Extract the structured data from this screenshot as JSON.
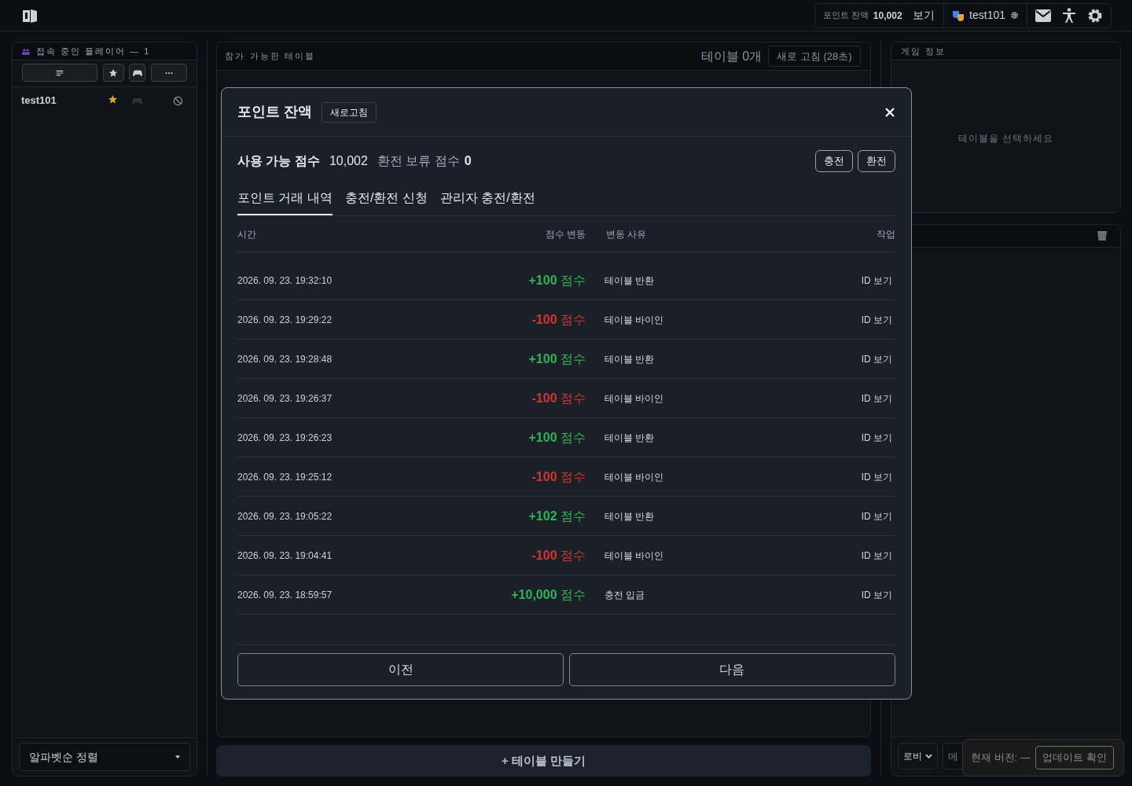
{
  "topbar": {
    "points_label": "포인트 잔액",
    "points_value": "10,002",
    "view_button": "보기",
    "username": "test101"
  },
  "players_panel": {
    "title": "접속 중인 플레이어 — 1",
    "players": [
      {
        "name": "test101",
        "favorite": true
      }
    ],
    "sort_select": "알파벳순 정렬"
  },
  "tables_panel": {
    "title": "참가 가능한 테이블",
    "count": "테이블 0개",
    "refresh_button": "새로 고침 (28초)",
    "create_button": "+ 테이블 만들기"
  },
  "game_info": {
    "title": "게임 정보",
    "empty": "테이블을 선택하세요"
  },
  "chat": {
    "channel": "로비",
    "placeholder": "메"
  },
  "version_toast": {
    "text": "현재 버전: —",
    "button": "업데이트 확인"
  },
  "modal": {
    "title": "포인트 잔액",
    "refresh_button": "새로고침",
    "available_label": "사용 가능 점수",
    "available_value": "10,002",
    "pending_label": "환전 보류 점수",
    "pending_value": "0",
    "buttons": [
      "충전",
      "환전"
    ],
    "tabs": [
      {
        "label": "포인트 거래 내역",
        "selected": true
      },
      {
        "label": "충전/환전 신청",
        "selected": false
      },
      {
        "label": "관리자 충전/환전",
        "selected": false
      }
    ],
    "columns": [
      "시간",
      "점수 변동",
      "변동 사유",
      "작업"
    ],
    "rows": [
      {
        "time": "2026. 09. 23. 19:32:10",
        "amount": "+100",
        "unit": "점수",
        "kind": "credit",
        "reason": "테이블 반환",
        "action": "ID 보기"
      },
      {
        "time": "2026. 09. 23. 19:29:22",
        "amount": "-100",
        "unit": "점수",
        "kind": "debit",
        "reason": "테이블 바이인",
        "action": "ID 보기"
      },
      {
        "time": "2026. 09. 23. 19:28:48",
        "amount": "+100",
        "unit": "점수",
        "kind": "credit",
        "reason": "테이블 반환",
        "action": "ID 보기"
      },
      {
        "time": "2026. 09. 23. 19:26:37",
        "amount": "-100",
        "unit": "점수",
        "kind": "debit",
        "reason": "테이블 바이인",
        "action": "ID 보기"
      },
      {
        "time": "2026. 09. 23. 19:26:23",
        "amount": "+100",
        "unit": "점수",
        "kind": "credit",
        "reason": "테이블 반환",
        "action": "ID 보기"
      },
      {
        "time": "2026. 09. 23. 19:25:12",
        "amount": "-100",
        "unit": "점수",
        "kind": "debit",
        "reason": "테이블 바이인",
        "action": "ID 보기"
      },
      {
        "time": "2026. 09. 23. 19:05:22",
        "amount": "+102",
        "unit": "점수",
        "kind": "credit",
        "reason": "테이블 반환",
        "action": "ID 보기"
      },
      {
        "time": "2026. 09. 23. 19:04:41",
        "amount": "-100",
        "unit": "점수",
        "kind": "debit",
        "reason": "테이블 바이인",
        "action": "ID 보기"
      },
      {
        "time": "2026. 09. 23. 18:59:57",
        "amount": "+10,000",
        "unit": "점수",
        "kind": "credit",
        "reason": "충전 입금",
        "action": "ID 보기"
      }
    ],
    "prev_button": "이전",
    "next_button": "다음"
  }
}
